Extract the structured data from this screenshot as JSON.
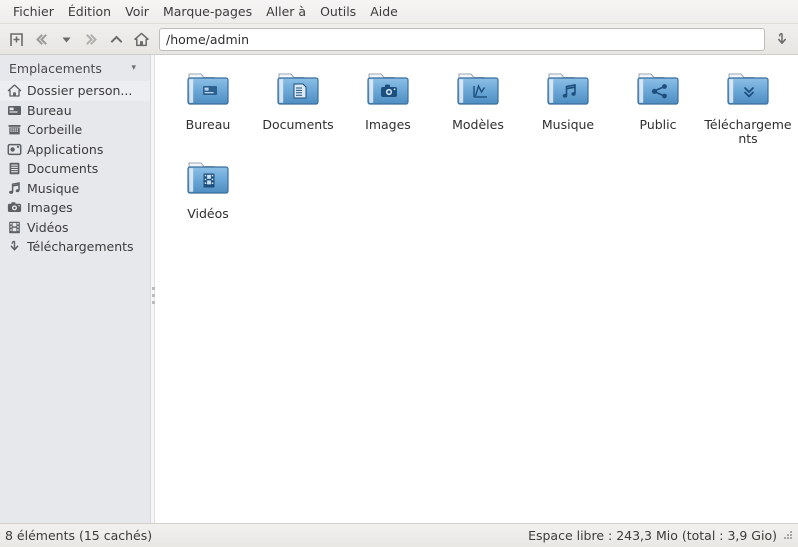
{
  "menubar": {
    "items": [
      {
        "label": "Fichier",
        "name": "menu-fichier"
      },
      {
        "label": "Édition",
        "name": "menu-edition"
      },
      {
        "label": "Voir",
        "name": "menu-voir"
      },
      {
        "label": "Marque-pages",
        "name": "menu-marque-pages"
      },
      {
        "label": "Aller à",
        "name": "menu-aller-a"
      },
      {
        "label": "Outils",
        "name": "menu-outils"
      },
      {
        "label": "Aide",
        "name": "menu-aide"
      }
    ]
  },
  "toolbar": {
    "buttons": [
      {
        "icon": "new-tab-icon"
      },
      {
        "icon": "back-icon"
      },
      {
        "icon": "history-dropdown-icon"
      },
      {
        "icon": "forward-icon"
      },
      {
        "icon": "up-icon"
      },
      {
        "icon": "home-icon"
      }
    ],
    "address": {
      "value": "/home/admin",
      "placeholder": "/home/admin"
    },
    "right_button": {
      "icon": "go-down-icon"
    }
  },
  "sidebar": {
    "header": {
      "title": "Emplacements",
      "caret": "▾"
    },
    "items": [
      {
        "label": "Dossier person...",
        "icon": "home-icon",
        "selected": true
      },
      {
        "label": "Bureau",
        "icon": "desktop-icon",
        "selected": false
      },
      {
        "label": "Corbeille",
        "icon": "trash-icon",
        "selected": false
      },
      {
        "label": "Applications",
        "icon": "applications-icon",
        "selected": false
      },
      {
        "label": "Documents",
        "icon": "documents-icon",
        "selected": false
      },
      {
        "label": "Musique",
        "icon": "music-icon",
        "selected": false
      },
      {
        "label": "Images",
        "icon": "camera-icon",
        "selected": false
      },
      {
        "label": "Vidéos",
        "icon": "film-icon",
        "selected": false
      },
      {
        "label": "Téléchargements",
        "icon": "download-icon",
        "selected": false
      }
    ]
  },
  "files": {
    "items": [
      {
        "label": "Bureau",
        "emblem": "desktop-emblem"
      },
      {
        "label": "Documents",
        "emblem": "document-emblem"
      },
      {
        "label": "Images",
        "emblem": "camera-emblem"
      },
      {
        "label": "Modèles",
        "emblem": "template-emblem"
      },
      {
        "label": "Musique",
        "emblem": "music-emblem"
      },
      {
        "label": "Public",
        "emblem": "share-emblem"
      },
      {
        "label": "Téléchargements",
        "emblem": "download-emblem"
      },
      {
        "label": "Vidéos",
        "emblem": "film-emblem"
      }
    ]
  },
  "statusbar": {
    "left": "8 éléments (15 cachés)",
    "right": "Espace libre : 243,3 Mio (total : 3,9 Gio)"
  },
  "colors": {
    "folder_blue": "#5b9bd1",
    "folder_blue_dark": "#3a74ad",
    "sidebar_bg": "#e7e8ec",
    "selected_bg": "#eceef1",
    "text": "#3c3c3c"
  }
}
